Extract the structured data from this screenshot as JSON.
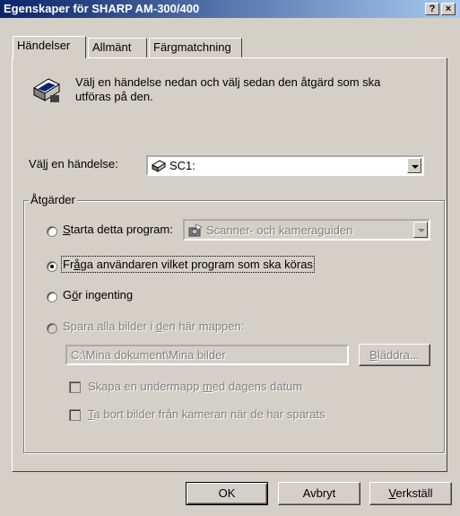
{
  "window": {
    "title": "Egenskaper för SHARP AM-300/400",
    "help_label": "?",
    "close_label": "×"
  },
  "tabs": [
    {
      "label": "Händelser"
    },
    {
      "label": "Allmänt"
    },
    {
      "label": "Färgmatchning"
    }
  ],
  "intro": {
    "line1": "Välj en händelse nedan och välj sedan den åtgärd som ska",
    "line2": "utföras på den."
  },
  "event": {
    "label_pre": "Vä",
    "label_acc": "l",
    "label_post": "j en händelse:",
    "value": "SC1:"
  },
  "actions": {
    "title": "Åtgärder",
    "start_program": {
      "acc": "S",
      "rest": "tarta detta program:",
      "program_value": "Scanner- och kameraguiden"
    },
    "ask_user": {
      "pre": "Fr",
      "acc": "å",
      "post": "ga användaren vilket program som ska köras"
    },
    "do_nothing": {
      "pre": "G",
      "acc": "ö",
      "post": "r ingenting"
    },
    "save_all": {
      "pre": "Spara alla bilder i ",
      "acc": "d",
      "post": "en här mappen:",
      "path": "C:\\Mina dokument\\Mina bilder",
      "browse_acc": "B",
      "browse_rest": "läddra..."
    },
    "subfolder": {
      "pre": "Skapa en undermapp ",
      "acc": "m",
      "post": "ed dagens datum"
    },
    "delete": {
      "acc": "T",
      "rest": "a bort bilder från kameran när de har sparats"
    }
  },
  "buttons": {
    "ok": "OK",
    "cancel": "Avbryt",
    "apply_acc": "V",
    "apply_rest": "erkställ"
  }
}
